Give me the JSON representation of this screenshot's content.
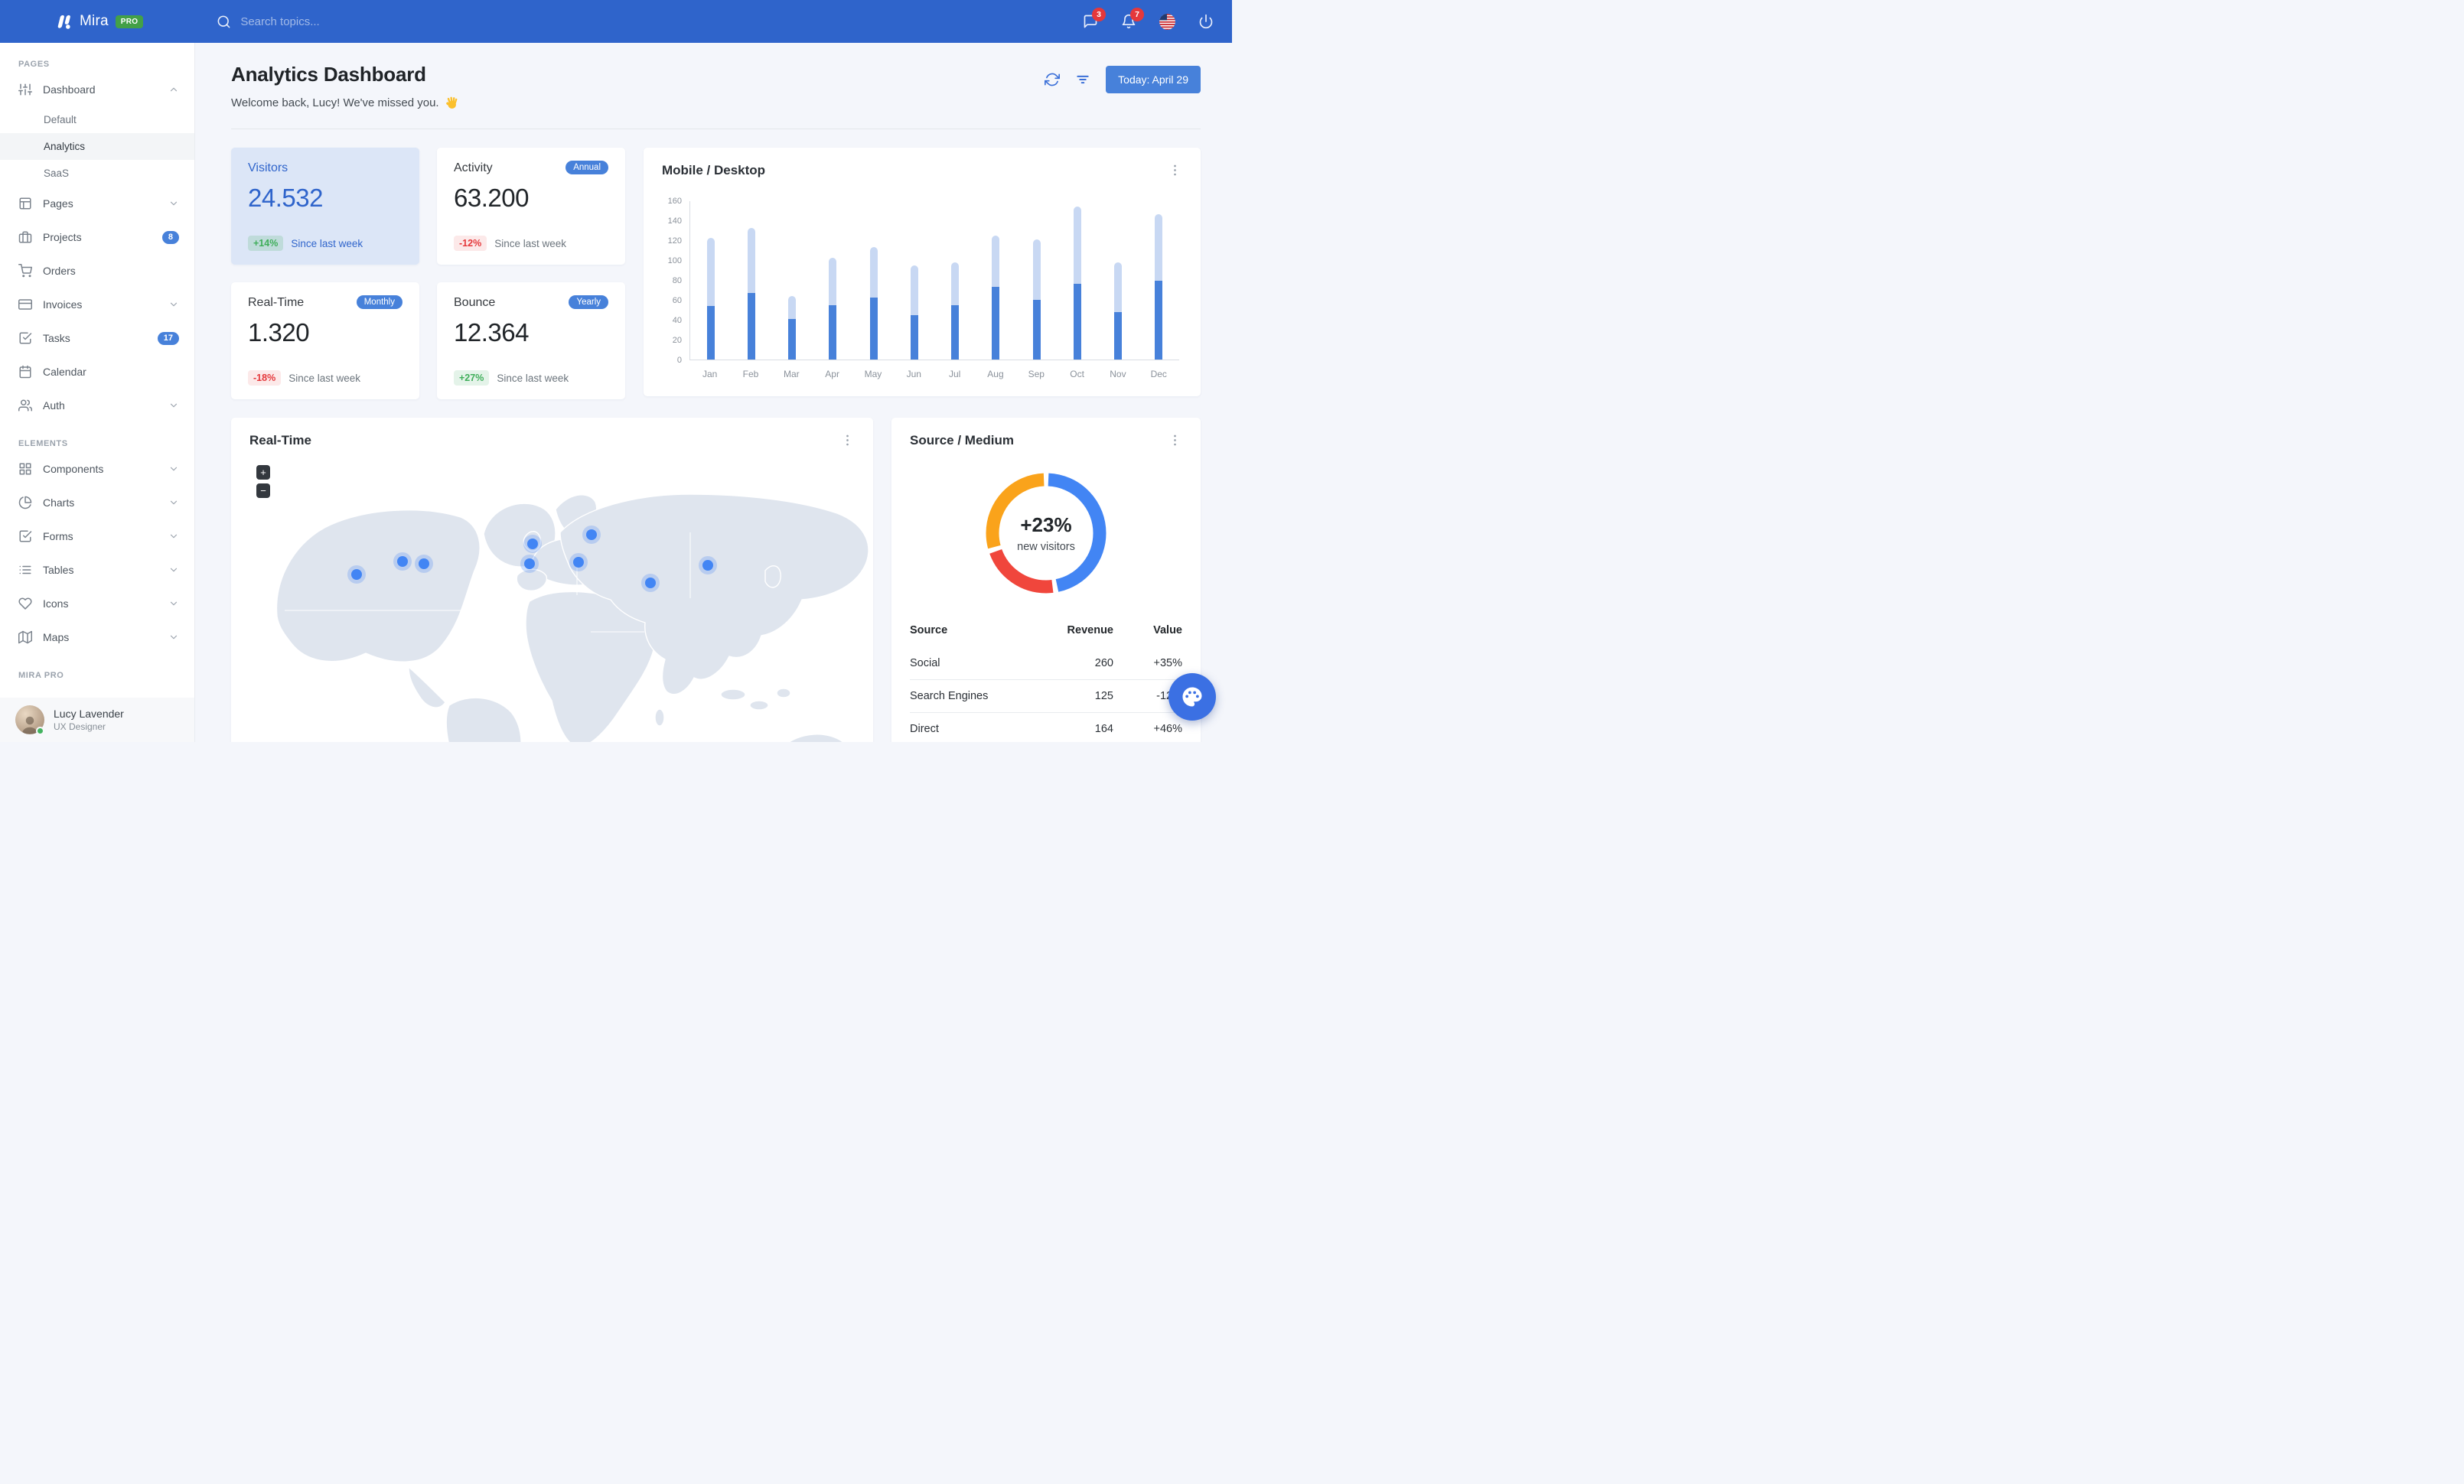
{
  "navbar": {
    "brand": "Mira",
    "brand_badge": "PRO",
    "search_placeholder": "Search topics...",
    "messages_badge": "3",
    "alerts_badge": "7"
  },
  "sidebar": {
    "sections": [
      {
        "label": "PAGES",
        "items": [
          {
            "label": "Dashboard",
            "icon": "sliders",
            "chevron": "up",
            "children": [
              {
                "label": "Default",
                "active": false
              },
              {
                "label": "Analytics",
                "active": true
              },
              {
                "label": "SaaS",
                "active": false
              }
            ]
          },
          {
            "label": "Pages",
            "icon": "layout",
            "chevron": "down"
          },
          {
            "label": "Projects",
            "icon": "briefcase",
            "badge": "8"
          },
          {
            "label": "Orders",
            "icon": "shopping-cart"
          },
          {
            "label": "Invoices",
            "icon": "credit-card",
            "chevron": "down"
          },
          {
            "label": "Tasks",
            "icon": "check-square",
            "badge": "17"
          },
          {
            "label": "Calendar",
            "icon": "calendar"
          },
          {
            "label": "Auth",
            "icon": "users",
            "chevron": "down"
          }
        ]
      },
      {
        "label": "ELEMENTS",
        "items": [
          {
            "label": "Components",
            "icon": "grid",
            "chevron": "down"
          },
          {
            "label": "Charts",
            "icon": "pie-chart",
            "chevron": "down"
          },
          {
            "label": "Forms",
            "icon": "check-square",
            "chevron": "down"
          },
          {
            "label": "Tables",
            "icon": "list",
            "chevron": "down"
          },
          {
            "label": "Icons",
            "icon": "heart",
            "chevron": "down"
          },
          {
            "label": "Maps",
            "icon": "map",
            "chevron": "down"
          }
        ]
      },
      {
        "label": "MIRA PRO",
        "items": []
      }
    ],
    "user": {
      "name": "Lucy Lavender",
      "role": "UX Designer",
      "status": "online"
    }
  },
  "header": {
    "title": "Analytics Dashboard",
    "subtitle": "Welcome back, Lucy! We've missed you.",
    "date_button": "Today: April 29"
  },
  "stats": [
    {
      "title": "Visitors",
      "value": "24.532",
      "delta": "+14%",
      "delta_dir": "up",
      "caption": "Since last week",
      "variant": "highlight"
    },
    {
      "title": "Activity",
      "value": "63.200",
      "delta": "-12%",
      "delta_dir": "down",
      "caption": "Since last week",
      "pill": "Annual"
    },
    {
      "title": "Real-Time",
      "value": "1.320",
      "delta": "-18%",
      "delta_dir": "down",
      "caption": "Since last week",
      "pill": "Monthly"
    },
    {
      "title": "Bounce",
      "value": "12.364",
      "delta": "+27%",
      "delta_dir": "up",
      "caption": "Since last week",
      "pill": "Yearly"
    }
  ],
  "chart_data": [
    {
      "type": "bar",
      "stacked": true,
      "title": "Mobile / Desktop",
      "categories": [
        "Jan",
        "Feb",
        "Mar",
        "Apr",
        "May",
        "Jun",
        "Jul",
        "Aug",
        "Sep",
        "Oct",
        "Nov",
        "Dec"
      ],
      "series": [
        {
          "name": "Mobile",
          "color": "#4781DA",
          "values": [
            54,
            67,
            41,
            55,
            62,
            45,
            55,
            73,
            60,
            76,
            48,
            79
          ]
        },
        {
          "name": "Desktop",
          "color": "#C8D8F3",
          "values": [
            68,
            65,
            23,
            47,
            51,
            50,
            43,
            52,
            61,
            78,
            50,
            67
          ]
        }
      ],
      "ylim": [
        0,
        160
      ],
      "yticks": [
        0,
        20,
        40,
        60,
        80,
        100,
        120,
        140,
        160
      ],
      "grid": false,
      "legend": "none"
    },
    {
      "type": "donut",
      "title": "Source / Medium",
      "center_value": "+23%",
      "center_label": "new visitors",
      "slices": [
        {
          "name": "Social",
          "value": 260,
          "color": "#4285F4"
        },
        {
          "name": "Search Engines",
          "value": 125,
          "color": "#F0463C"
        },
        {
          "name": "Direct",
          "value": 164,
          "color": "#FAA31B"
        }
      ]
    }
  ],
  "realtime_map": {
    "title": "Real-Time",
    "zoom_in": "+",
    "zoom_out": "−",
    "markers": [
      {
        "name": "san-francisco",
        "x": 164,
        "y": 205
      },
      {
        "name": "chicago",
        "x": 224,
        "y": 188
      },
      {
        "name": "new-york",
        "x": 252,
        "y": 191
      },
      {
        "name": "london",
        "x": 394,
        "y": 165
      },
      {
        "name": "madrid",
        "x": 390,
        "y": 191
      },
      {
        "name": "moscow",
        "x": 471,
        "y": 153
      },
      {
        "name": "istanbul",
        "x": 454,
        "y": 189
      },
      {
        "name": "delhi",
        "x": 548,
        "y": 216
      },
      {
        "name": "beijing",
        "x": 623,
        "y": 193
      }
    ]
  },
  "source_table": {
    "columns": [
      "Source",
      "Revenue",
      "Value"
    ],
    "rows": [
      {
        "source": "Social",
        "revenue": "260",
        "value": "+35%",
        "dir": "up"
      },
      {
        "source": "Search Engines",
        "revenue": "125",
        "value": "-12%",
        "dir": "down"
      },
      {
        "source": "Direct",
        "revenue": "164",
        "value": "+46%",
        "dir": "up"
      }
    ]
  },
  "colors": {
    "navbar": "#2F64CB",
    "accent": "#4781DA",
    "green": "#3FAE5A",
    "red": "#E5383B",
    "bar_mobile": "#4781DA",
    "bar_desktop": "#C8D8F3",
    "donut_blue": "#4285F4",
    "donut_red": "#F0463C",
    "donut_orange": "#FAA31B",
    "highlight_card": "#DCE6F7"
  }
}
